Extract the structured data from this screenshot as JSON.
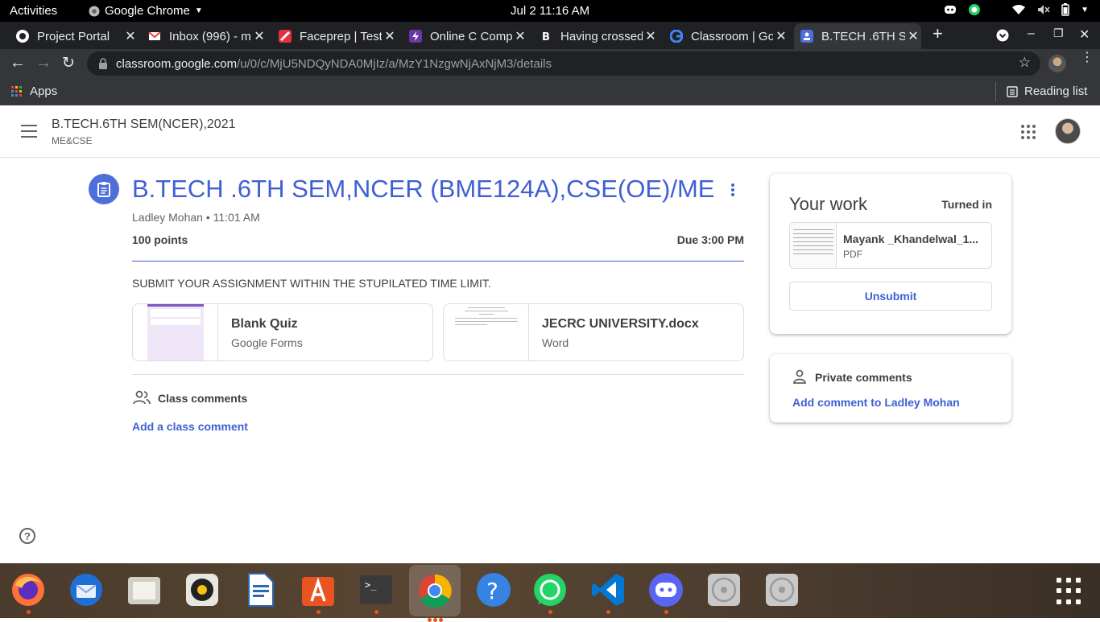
{
  "system_bar": {
    "activities": "Activities",
    "app_name": "Google Chrome",
    "clock": "Jul 2  11:16 AM"
  },
  "browser": {
    "tabs": [
      {
        "title": "Project Portal",
        "favicon": "github-icon"
      },
      {
        "title": "Inbox (996) - m",
        "favicon": "gmail-icon"
      },
      {
        "title": "Faceprep | Test",
        "favicon": "faceprep-icon"
      },
      {
        "title": "Online C Comp",
        "favicon": "bolt-icon"
      },
      {
        "title": "Having crossed",
        "favicon": "bing-icon"
      },
      {
        "title": "Classroom | Go",
        "favicon": "google-icon"
      },
      {
        "title": "B.TECH .6TH SE",
        "favicon": "classroom-icon",
        "active": true
      }
    ],
    "url_host": "classroom.google.com",
    "url_path": "/u/0/c/MjU5NDQyNDA0MjIz/a/MzY1NzgwNjAxNjM3/details",
    "bookmarks": {
      "apps": "Apps",
      "reading_list": "Reading list"
    }
  },
  "classroom": {
    "class_name": "B.TECH.6TH SEM(NCER),2021",
    "class_section": "ME&CSE",
    "assignment": {
      "title": "B.TECH .6TH SEM,NCER (BME124A),CSE(OE)/ME",
      "meta": "Ladley Mohan • 11:01 AM",
      "points": "100 points",
      "due": "Due 3:00 PM",
      "instructions": "SUBMIT YOUR ASSIGNMENT WITHIN THE STUPILATED TIME LIMIT.",
      "attachments": [
        {
          "name": "Blank Quiz",
          "type": "Google Forms"
        },
        {
          "name": "JECRC UNIVERSITY.docx",
          "type": "Word"
        }
      ],
      "class_comments_label": "Class comments",
      "add_class_comment": "Add a class comment"
    },
    "your_work": {
      "title": "Your work",
      "status": "Turned in",
      "file_name": "Mayank _Khandelwal_1...",
      "file_type": "PDF",
      "unsubmit_label": "Unsubmit"
    },
    "private_comments": {
      "label": "Private comments",
      "add_label": "Add comment to Ladley Mohan"
    },
    "help_glyph": "?"
  },
  "colors": {
    "accent": "#3f5fd4",
    "chrome_dark": "#202124",
    "chrome_toolbar": "#35363a"
  },
  "dock": [
    "firefox-icon",
    "thunderbird-icon",
    "files-icon",
    "rhythmbox-icon",
    "libreoffice-writer-icon",
    "software-icon",
    "terminal-icon",
    "chrome-icon",
    "help-icon",
    "whatsapp-icon",
    "vscode-icon",
    "discord-icon",
    "disc-icon",
    "disc-icon",
    "show-apps-icon"
  ]
}
